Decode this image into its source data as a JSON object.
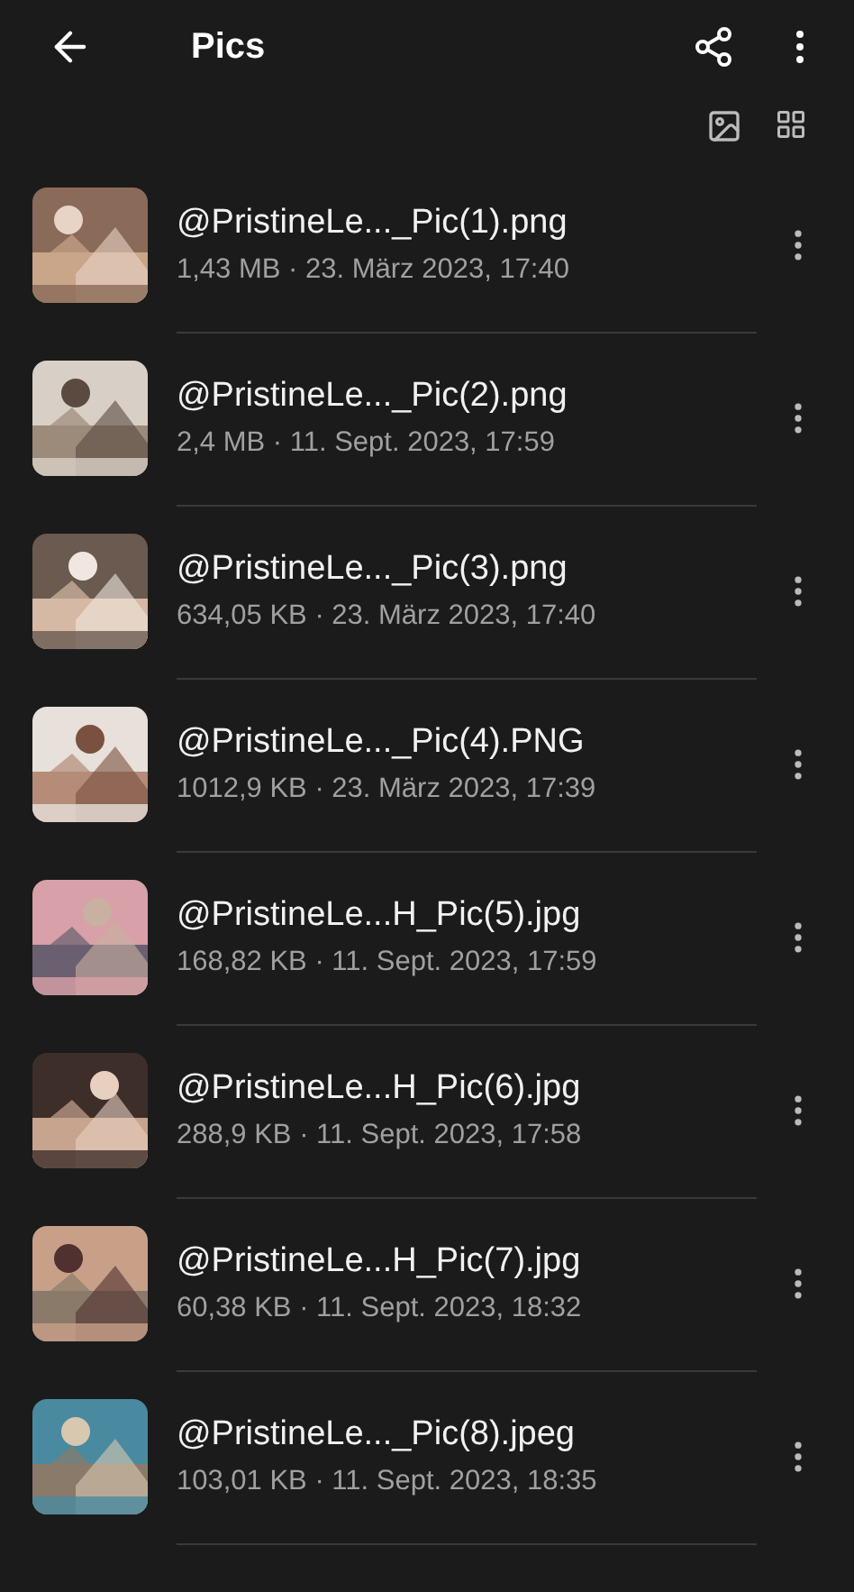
{
  "toolbar": {
    "title": "Pics"
  },
  "files": [
    {
      "name": "@PristineLe..._Pic(1).png",
      "details": "1,43 MB · 23. März 2023, 17:40"
    },
    {
      "name": "@PristineLe..._Pic(2).png",
      "details": "2,4 MB · 11. Sept. 2023, 17:59"
    },
    {
      "name": "@PristineLe..._Pic(3).png",
      "details": "634,05 KB · 23. März 2023, 17:40"
    },
    {
      "name": "@PristineLe..._Pic(4).PNG",
      "details": "1012,9 KB · 23. März 2023, 17:39"
    },
    {
      "name": "@PristineLe...H_Pic(5).jpg",
      "details": "168,82 KB · 11. Sept. 2023, 17:59"
    },
    {
      "name": "@PristineLe...H_Pic(6).jpg",
      "details": "288,9 KB · 11. Sept. 2023, 17:58"
    },
    {
      "name": "@PristineLe...H_Pic(7).jpg",
      "details": "60,38 KB · 11. Sept. 2023, 18:32"
    },
    {
      "name": "@PristineLe..._Pic(8).jpeg",
      "details": "103,01 KB · 11. Sept. 2023, 18:35"
    }
  ]
}
